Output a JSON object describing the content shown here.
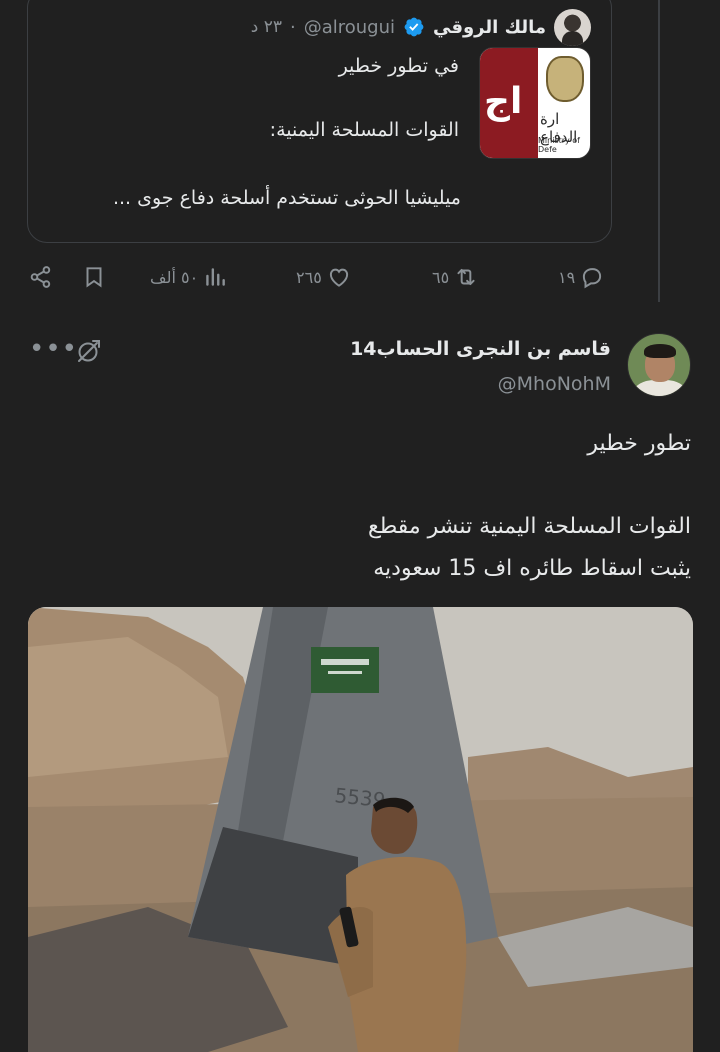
{
  "quoted_tweet": {
    "author_name": "مالك الروقي",
    "handle": "@alrougui",
    "separator": "·",
    "time": "٢٣ د",
    "thumbnail": {
      "brand_letters": "اج",
      "ministry_arabic": "ارة الدفاع",
      "ministry_english": "Ministry of Defe"
    },
    "lines": [
      "في تطور خطير",
      "القوات المسلحة اليمنية:",
      "ميليشيا الحوثى تستخدم أسلحة دفاع جوى ..."
    ]
  },
  "actions": {
    "replies": "١٩",
    "retweets": "٦٥",
    "likes": "٢٦٥",
    "views": "٥٠ ألف"
  },
  "tweet": {
    "author_name": "قاسم بن النجرى الحساب14",
    "handle": "@MhoNohM",
    "line1": "تطور خطير",
    "line2": "القوات المسلحة اليمنية تنشر مقطع",
    "line3": "يثبت  اسقاط طائره اف 15 سعوديه"
  },
  "photo": {
    "tail_number": "5539"
  },
  "colors": {
    "background": "#202020",
    "text": "#e7e9ea",
    "muted": "#8b9196",
    "verified": "#1d9bf0",
    "border": "#3c3f43"
  }
}
